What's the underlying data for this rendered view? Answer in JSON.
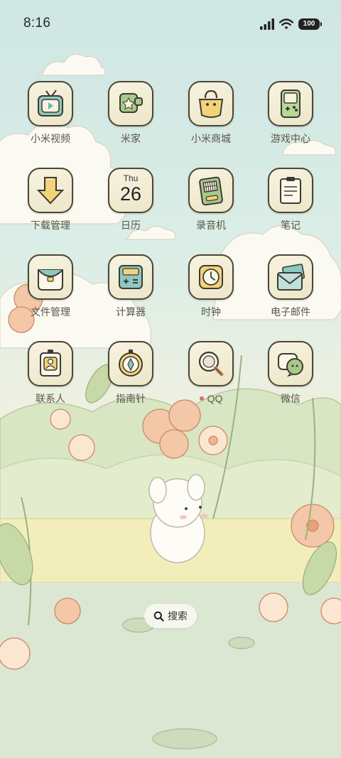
{
  "status_bar": {
    "time": "8:16",
    "battery_level": "100"
  },
  "home_grid": {
    "rows": [
      [
        {
          "label": "小米视频",
          "icon": "tv-icon"
        },
        {
          "label": "米家",
          "icon": "puzzle-icon"
        },
        {
          "label": "小米商城",
          "icon": "shopping-bag-icon"
        },
        {
          "label": "游戏中心",
          "icon": "handheld-console-icon"
        }
      ],
      [
        {
          "label": "下载管理",
          "icon": "download-arrow-icon"
        },
        {
          "label": "日历",
          "icon": "calendar-icon"
        },
        {
          "label": "录音机",
          "icon": "recorder-icon"
        },
        {
          "label": "笔记",
          "icon": "notepad-icon"
        }
      ],
      [
        {
          "label": "文件管理",
          "icon": "folder-bag-icon"
        },
        {
          "label": "计算器",
          "icon": "calculator-icon"
        },
        {
          "label": "时钟",
          "icon": "clock-icon"
        },
        {
          "label": "电子邮件",
          "icon": "envelope-icon"
        }
      ],
      [
        {
          "label": "联系人",
          "icon": "contact-badge-icon"
        },
        {
          "label": "指南针",
          "icon": "compass-icon"
        },
        {
          "label": "QQ",
          "icon": "magnifier-icon",
          "new_install_dot": true
        },
        {
          "label": "微信",
          "icon": "chat-bubbles-icon"
        }
      ]
    ]
  },
  "calendar": {
    "day_of_week": "Thu",
    "date": "26"
  },
  "search": {
    "label": "搜索"
  },
  "dock": [
    {
      "icon": "walkie-talkie-icon"
    },
    {
      "icon": "flower-icon"
    },
    {
      "icon": "leaf-message-icon"
    },
    {
      "icon": "camera-icon"
    }
  ]
}
